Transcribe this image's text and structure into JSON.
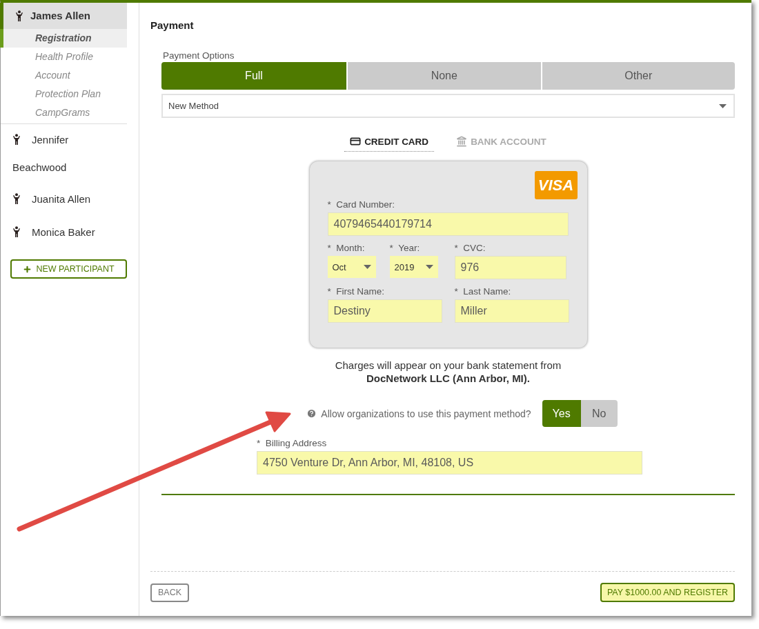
{
  "sidebar": {
    "participants": [
      {
        "name": "James Allen",
        "expanded": true,
        "items": [
          {
            "label": "Registration",
            "selected": true
          },
          {
            "label": "Health Profile",
            "selected": false
          },
          {
            "label": "Account",
            "selected": false
          },
          {
            "label": "Protection Plan",
            "selected": false
          },
          {
            "label": "CampGrams",
            "selected": false
          }
        ]
      },
      {
        "name": "Jennifer Beachwood",
        "expanded": false
      },
      {
        "name": "Juanita Allen",
        "expanded": false
      },
      {
        "name": "Monica Baker",
        "expanded": false
      }
    ],
    "new_participant_button": "NEW PARTICIPANT"
  },
  "main": {
    "title": "Payment",
    "payment_options": {
      "label": "Payment Options",
      "options": [
        {
          "label": "Full",
          "selected": true
        },
        {
          "label": "None",
          "selected": false
        },
        {
          "label": "Other",
          "selected": false
        }
      ]
    },
    "method_select": {
      "value": "New Method"
    },
    "method_tabs": [
      {
        "label": "CREDIT CARD",
        "kind": "card",
        "selected": true
      },
      {
        "label": "BANK ACCOUNT",
        "kind": "bank",
        "selected": false
      }
    ],
    "card": {
      "brand": "VISA",
      "rows": [
        {
          "fields": [
            {
              "mark": "*",
              "label": "Card Number:",
              "kind": "input",
              "value": "4079465440179714"
            }
          ]
        },
        {
          "fields": [
            {
              "mark": "*",
              "label": "Month:",
              "kind": "select",
              "value": "Oct"
            },
            {
              "mark": "*",
              "label": "Year:",
              "kind": "select",
              "value": "2019"
            },
            {
              "mark": "*",
              "label": "CVC:",
              "kind": "input",
              "value": "976"
            }
          ]
        },
        {
          "fields": [
            {
              "mark": "*",
              "label": "First Name:",
              "kind": "input",
              "value": "Destiny"
            },
            {
              "mark": "*",
              "label": "Last Name:",
              "kind": "input",
              "value": "Miller"
            }
          ]
        }
      ]
    },
    "notice": "Charges will appear on your bank statement from\n**DocNetwork LLC (Ann Arbor, MI).**",
    "allow": {
      "question": "Allow organizations to use this payment method?",
      "options": [
        {
          "label": "Yes",
          "selected": true
        },
        {
          "label": "No",
          "selected": false
        }
      ]
    },
    "billing": {
      "mark": "*",
      "label": "Billing Address",
      "value": "4750 Venture Dr, Ann Arbor, MI, 48108, US"
    },
    "footer": {
      "back_button": "BACK",
      "pay_button": "PAY $1000.00 AND REGISTER"
    }
  }
}
